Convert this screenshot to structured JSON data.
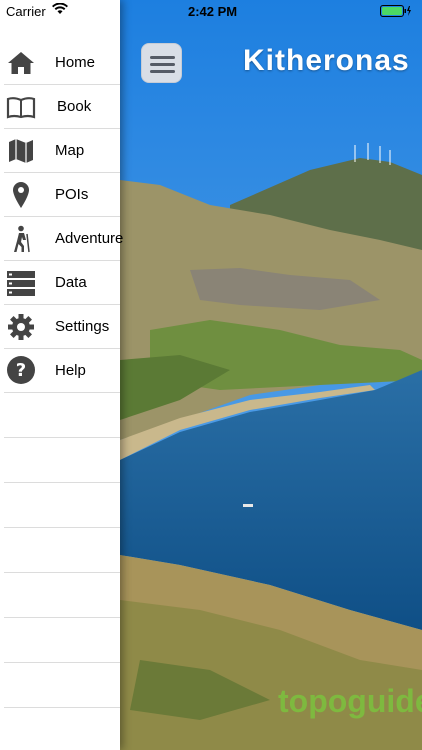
{
  "status_bar": {
    "carrier": "Carrier",
    "time": "2:42 PM"
  },
  "header": {
    "title": "Kitheronas"
  },
  "watermark": {
    "text": "topoguide"
  },
  "menu": {
    "items": [
      {
        "label": "Home",
        "icon": "home-icon"
      },
      {
        "label": "Book",
        "icon": "book-icon"
      },
      {
        "label": "Map",
        "icon": "map-icon"
      },
      {
        "label": "POIs",
        "icon": "location-pin-icon"
      },
      {
        "label": "Adventure",
        "icon": "hiker-icon"
      },
      {
        "label": "Data",
        "icon": "server-icon"
      },
      {
        "label": "Settings",
        "icon": "gear-icon"
      },
      {
        "label": "Help",
        "icon": "help-icon"
      }
    ]
  },
  "colors": {
    "accent": "#4cd964",
    "sidebar_icon": "#444444"
  }
}
